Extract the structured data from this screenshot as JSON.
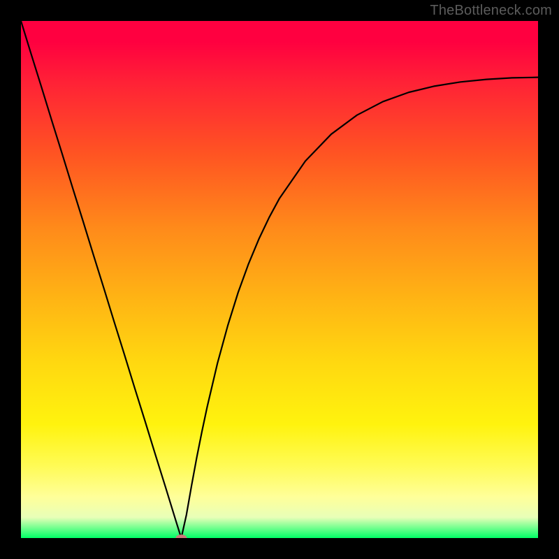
{
  "watermark": "TheBottleneck.com",
  "chart_data": {
    "type": "line",
    "title": "",
    "xlabel": "",
    "ylabel": "",
    "xlim": [
      0,
      100
    ],
    "ylim": [
      0,
      100
    ],
    "grid": false,
    "legend": false,
    "background_gradient": {
      "top_color": "#ff0040",
      "mid_color": "#ffe010",
      "bottom_color": "#00ff66"
    },
    "series": [
      {
        "name": "bottleneck_curve",
        "x": [
          0,
          2,
          4,
          6,
          8,
          10,
          12,
          14,
          16,
          18,
          20,
          22,
          24,
          26,
          28,
          30,
          31,
          32,
          33,
          34,
          35,
          36,
          38,
          40,
          42,
          44,
          46,
          48,
          50,
          55,
          60,
          65,
          70,
          75,
          80,
          85,
          90,
          95,
          100
        ],
        "y": [
          100,
          93.5,
          87.1,
          80.6,
          74.2,
          67.7,
          61.3,
          54.8,
          48.4,
          41.9,
          35.5,
          29.0,
          22.6,
          16.1,
          9.7,
          3.2,
          0.0,
          4.5,
          10.2,
          15.6,
          20.6,
          25.3,
          33.8,
          41.1,
          47.5,
          53.0,
          57.8,
          62.0,
          65.7,
          72.9,
          78.1,
          81.8,
          84.4,
          86.2,
          87.4,
          88.2,
          88.7,
          89.0,
          89.1
        ]
      }
    ],
    "minimum_point": {
      "x": 31,
      "y": 0
    },
    "annotations": []
  }
}
